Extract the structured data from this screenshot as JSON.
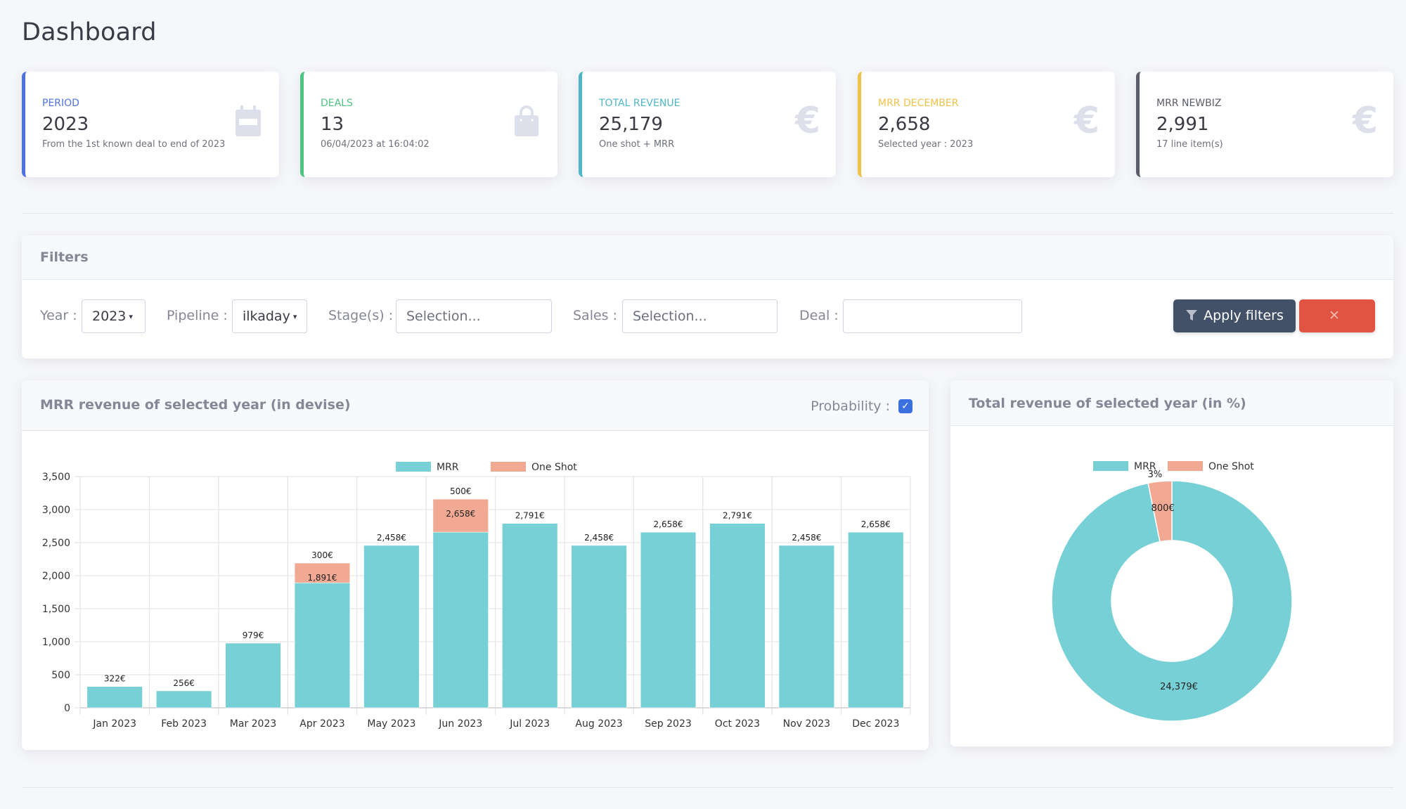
{
  "page": {
    "title": "Dashboard"
  },
  "kpis": [
    {
      "label": "Period",
      "value": "2023",
      "sub": "From the 1st known deal to end of 2023",
      "icon": "calendar-icon",
      "color": "#4e73df"
    },
    {
      "label": "Deals",
      "value": "13",
      "sub": "06/04/2023 at 16:04:02",
      "icon": "shopping-bag-icon",
      "color": "#4fc381"
    },
    {
      "label": "Total revenue",
      "value": "25,179",
      "sub": "One shot + MRR",
      "icon": "euro-icon",
      "icon_glyph": "€",
      "color": "#4fb6c8"
    },
    {
      "label": "MRR December",
      "value": "2,658",
      "sub": "Selected year : 2023",
      "icon": "euro-icon",
      "icon_glyph": "€",
      "color": "#f0c24a"
    },
    {
      "label": "MRR Newbiz",
      "value": "2,991",
      "sub": "17 line item(s)",
      "icon": "euro-icon",
      "icon_glyph": "€",
      "color": "#5a5c69"
    }
  ],
  "filters": {
    "title": "Filters",
    "year_label": "Year :",
    "year_value": "2023",
    "pipeline_label": "Pipeline :",
    "pipeline_value": "ilkaday",
    "stages_label": "Stage(s) :",
    "stages_placeholder": "Selection...",
    "sales_label": "Sales :",
    "sales_placeholder": "Selection...",
    "deal_label": "Deal :",
    "deal_value": "",
    "apply_label": "Apply filters",
    "reset_label": "Reset",
    "caret": "▾",
    "reset_glyph": "✕"
  },
  "mrr_card": {
    "title": "MRR revenue of selected year (in devise)",
    "probability_label": "Probability :",
    "probability_checked": true,
    "check_glyph": "✓"
  },
  "pie_card": {
    "title": "Total revenue of selected year (in %)"
  },
  "colors": {
    "mrr": "#78d0d7",
    "one_shot": "#f1a993"
  },
  "chart_data": [
    {
      "type": "bar",
      "stacked": true,
      "title": "",
      "xlabel": "",
      "ylabel": "",
      "categories": [
        "Jan 2023",
        "Feb 2023",
        "Mar 2023",
        "Apr 2023",
        "May 2023",
        "Jun 2023",
        "Jul 2023",
        "Aug 2023",
        "Sep 2023",
        "Oct 2023",
        "Nov 2023",
        "Dec 2023"
      ],
      "series": [
        {
          "name": "MRR",
          "values": [
            322,
            256,
            979,
            1891,
            2458,
            2658,
            2791,
            2458,
            2658,
            2791,
            2458,
            2658
          ]
        },
        {
          "name": "One Shot",
          "values": [
            0,
            0,
            0,
            300,
            0,
            500,
            0,
            0,
            0,
            0,
            0,
            0
          ]
        }
      ],
      "value_suffix": "€",
      "ylim": [
        0,
        3500
      ],
      "yticks": [
        0,
        500,
        1000,
        1500,
        2000,
        2500,
        3000,
        3500
      ],
      "ytick_labels": [
        "0",
        "500",
        "1,000",
        "1,500",
        "2,000",
        "2,500",
        "3,000",
        "3,500"
      ],
      "grid": true,
      "legend": "top-center"
    },
    {
      "type": "pie",
      "donut": true,
      "labels": [
        "MRR",
        "One Shot"
      ],
      "values": [
        24379,
        800
      ],
      "value_labels": [
        "24,379€",
        "800€"
      ],
      "percent_labels": [
        "",
        "3%"
      ],
      "legend": "top-center"
    }
  ]
}
